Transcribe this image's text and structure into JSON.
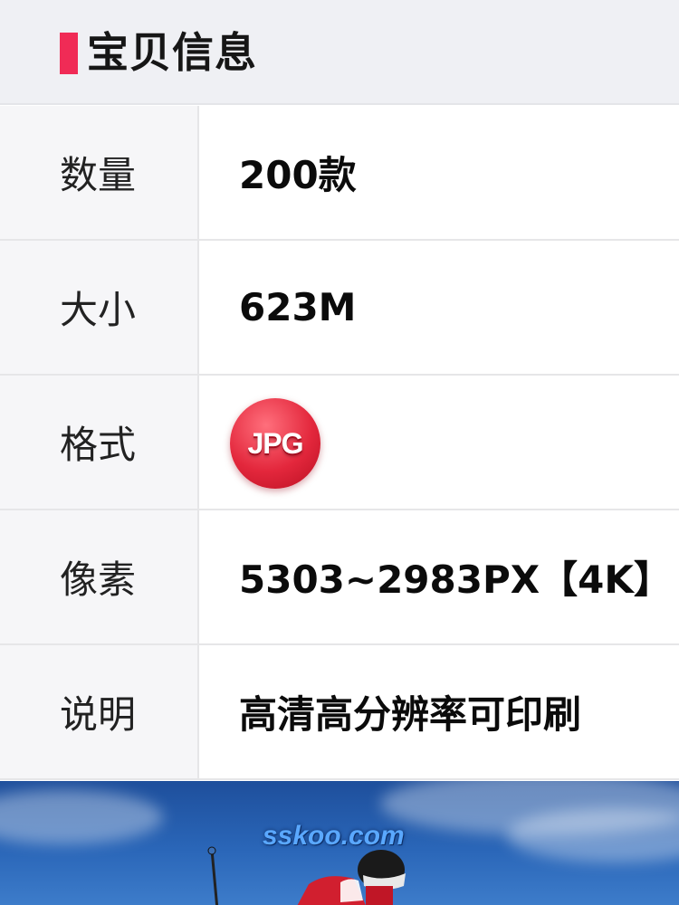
{
  "header": {
    "title": "宝贝信息",
    "accent_color": "#f02b56"
  },
  "rows": [
    {
      "label": "数量",
      "value": "200款"
    },
    {
      "label": "大小",
      "value": "623M"
    },
    {
      "label": "格式",
      "value": "",
      "badge": "JPG",
      "badge_color": "#e3273c"
    },
    {
      "label": "像素",
      "value": "5303~2983PX【4K】"
    },
    {
      "label": "说明",
      "value": "高清高分辨率可印刷"
    }
  ],
  "preview": {
    "watermark": "sskoo.com"
  }
}
